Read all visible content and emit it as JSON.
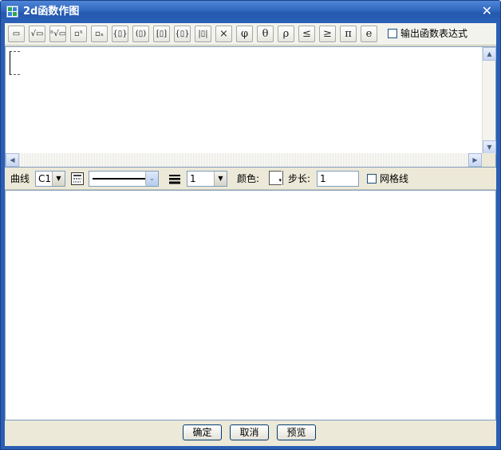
{
  "window": {
    "title": "2d函数作图",
    "close_glyph": "✕"
  },
  "toolbar": {
    "buttons": [
      {
        "name": "fraction",
        "glyph": "▭"
      },
      {
        "name": "sqrt",
        "glyph": "√▭"
      },
      {
        "name": "nth-root",
        "glyph": "ⁿ√▭"
      },
      {
        "name": "superscript",
        "glyph": "▫ˣ"
      },
      {
        "name": "subscript",
        "glyph": "▫ₓ"
      },
      {
        "name": "braces",
        "glyph": "{▯}"
      },
      {
        "name": "parentheses",
        "glyph": "(▯)"
      },
      {
        "name": "brackets",
        "glyph": "[▯]"
      },
      {
        "name": "curly-set",
        "glyph": "{▯}"
      },
      {
        "name": "absolute",
        "glyph": "|▯|"
      },
      {
        "name": "times",
        "glyph": "×"
      },
      {
        "name": "phi",
        "glyph": "φ"
      },
      {
        "name": "theta",
        "glyph": "θ"
      },
      {
        "name": "rho",
        "glyph": "ρ"
      },
      {
        "name": "leq",
        "glyph": "≤"
      },
      {
        "name": "geq",
        "glyph": "≥"
      },
      {
        "name": "pi",
        "glyph": "π"
      },
      {
        "name": "e",
        "glyph": "e"
      }
    ],
    "output_expression_label": "输出函数表达式",
    "output_expression_checked": false
  },
  "scroll": {
    "up_glyph": "▲",
    "down_glyph": "▼",
    "left_glyph": "◀",
    "right_glyph": "▶"
  },
  "options": {
    "curve_label": "曲线",
    "curve_value": "C1",
    "line_width_value": "1",
    "color_label": "颜色:",
    "step_label": "步长:",
    "step_value": "1",
    "grid_label": "网格线",
    "grid_checked": false,
    "dropdown_glyph": "▼",
    "chevron_glyph": "⌄",
    "color_tri_glyph": "▾"
  },
  "footer": {
    "ok_label": "确定",
    "cancel_label": "取消",
    "preview_label": "预览"
  },
  "colors": {
    "titlebar": "#2f66bd",
    "dialog_bg": "#ece9d8",
    "border_blue": "#7f9db9"
  }
}
